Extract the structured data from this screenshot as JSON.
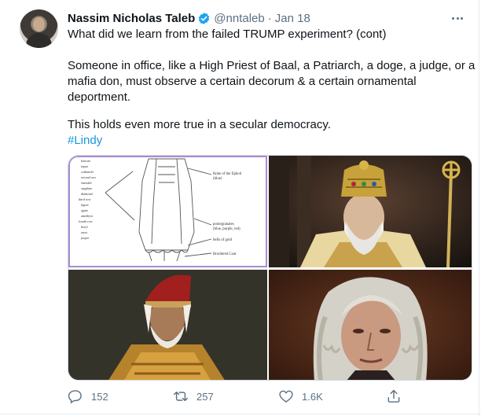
{
  "tweet": {
    "author_name": "Nassim Nicholas Taleb",
    "handle": "@nntaleb",
    "separator": "·",
    "date": "Jan 18",
    "lines": [
      "What did we learn from the failed TRUMP experiment? (cont)",
      "Someone in office, like a High Priest of Baal, a Patriarch, a doge, a judge, or a",
      "mafia don, must observe a certain decorum & a certain ornamental",
      "deportment.",
      "This holds even more true in a secular democracy."
    ],
    "hashtag": "#Lindy"
  },
  "media": {
    "diagram": {
      "list_items": [
        "bottom",
        "topaz",
        "carbuncle",
        "second row",
        "emerald",
        "sapphire",
        "diamond",
        "third row",
        "ligure",
        "agate",
        "amethyst",
        "fourth row",
        "beryl",
        "onyx",
        "jasper"
      ],
      "label_ephod": "Robe of the Ephod",
      "label_ephod_note": "(blue)",
      "label_pomegranates": "pomegranates",
      "label_pomegranates_note": "(blue, purple, red)",
      "label_bells": "bells of gold",
      "label_coat": "Broidered Coat"
    }
  },
  "actions": {
    "reply_count": "152",
    "retweet_count": "257",
    "like_count": "1.6K"
  },
  "colors": {
    "accent": "#1b95e0",
    "verified": "#1da1f2",
    "muted": "#5b7083"
  },
  "icons": [
    "verified-badge-icon",
    "more-icon",
    "reply-icon",
    "retweet-icon",
    "like-icon",
    "share-icon"
  ]
}
